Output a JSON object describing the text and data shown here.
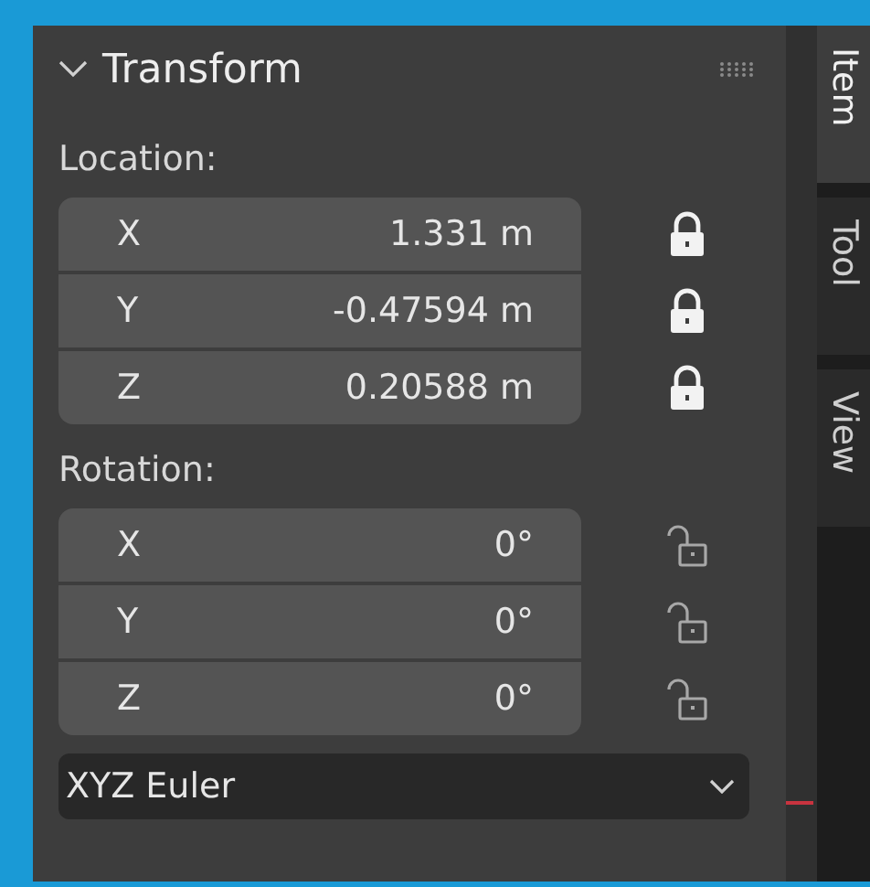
{
  "panel": {
    "title": "Transform",
    "expanded": true
  },
  "sections": [
    {
      "label": "Location:",
      "fields": [
        {
          "axis": "X",
          "value": "1.331 m",
          "locked": true
        },
        {
          "axis": "Y",
          "value": "-0.47594 m",
          "locked": true
        },
        {
          "axis": "Z",
          "value": "0.20588 m",
          "locked": true
        }
      ]
    },
    {
      "label": "Rotation:",
      "fields": [
        {
          "axis": "X",
          "value": "0°",
          "locked": false
        },
        {
          "axis": "Y",
          "value": "0°",
          "locked": false
        },
        {
          "axis": "Z",
          "value": "0°",
          "locked": false
        }
      ]
    }
  ],
  "rotation_mode": {
    "value": "XYZ Euler"
  },
  "tabs": [
    {
      "label": "Item",
      "selected": true
    },
    {
      "label": "Tool",
      "selected": false
    },
    {
      "label": "View",
      "selected": false
    }
  ]
}
